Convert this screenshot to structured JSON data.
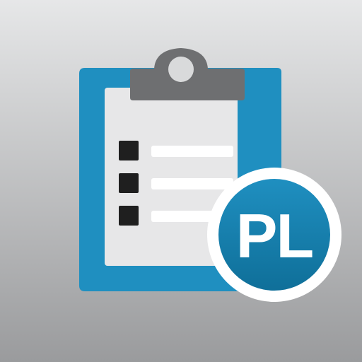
{
  "app_icon": {
    "icon_name": "clipboard-checklist-icon",
    "badge": {
      "text": "PL"
    },
    "checklist": {
      "item_count": 3
    },
    "colors": {
      "background_top": "#e6e7e8",
      "background_bottom": "#9a9b9d",
      "clipboard_blue": "#1f8fc0",
      "clipboard_blue_dark": "#0f6f99",
      "clip_gray": "#6e6f71",
      "paper": "#e7e7e8",
      "checkbox": "#1f1f1f",
      "line": "#ffffff",
      "badge_fill": "#0f7fb2",
      "badge_ring": "#ffffff",
      "badge_text": "#ffffff"
    }
  }
}
